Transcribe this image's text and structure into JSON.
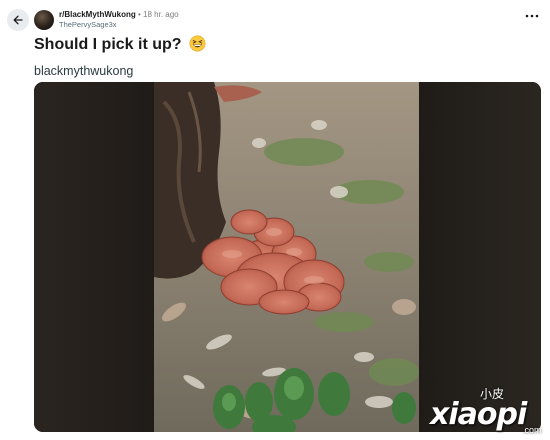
{
  "post": {
    "subreddit": "r/BlackMythWukong",
    "separator": "•",
    "time": "18 hr. ago",
    "author": "ThePervySage3x",
    "title": "Should I pick it up?",
    "flair": "blackmythwukong"
  },
  "watermark": {
    "cn_text": "小皮",
    "latin_text": "xiaopi",
    "domain": ".com"
  },
  "icons": {
    "back": "arrow-left-icon",
    "more": "more-horizontal-icon",
    "emoji": "grinning-squinting-face-emoji"
  }
}
